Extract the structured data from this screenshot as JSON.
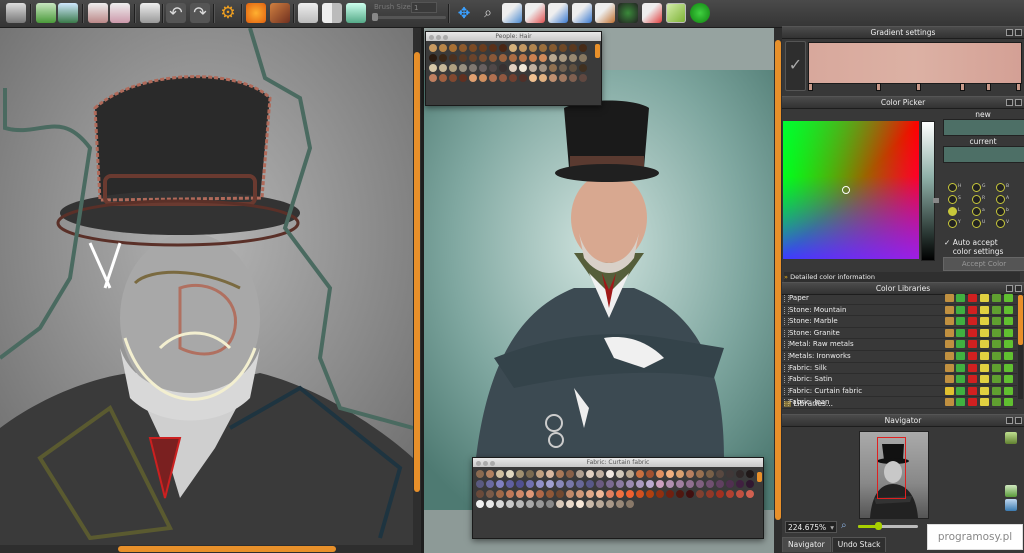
{
  "toolbar": {
    "brush_size_label": "Brush Size:",
    "brush_size_value": "1",
    "icons": [
      "open-image-icon",
      "export-icon",
      "save-icon",
      "undo-stack-icon",
      "clipboard-icon",
      "print-icon",
      "undo-icon",
      "redo-icon",
      "settings-gear-icon",
      "butterfly-icon",
      "picture-icon",
      "single-view-icon",
      "split-view-icon",
      "refresh-icon",
      "move-icon",
      "zoom-icon",
      "pen-icon",
      "pen2-icon",
      "pen3-icon",
      "pen4-icon",
      "pen5-icon",
      "brush-icon",
      "tree-icon",
      "eraser-icon",
      "paint-icon",
      "green-run-icon"
    ]
  },
  "palette_windows": [
    {
      "title": "People: Hair"
    },
    {
      "title": "Fabric: Curtain fabric"
    }
  ],
  "panels": {
    "gradient": {
      "title": "Gradient settings"
    },
    "color_picker": {
      "title": "Color Picker",
      "new_label": "new",
      "current_label": "current",
      "auto_accept": "Auto accept color settings",
      "accept_button": "Accept Color",
      "detailed": "Detailed color information",
      "swatch_color": "#4d6f66"
    },
    "color_libraries": {
      "title": "Color Libraries",
      "items": [
        "Paper",
        "Stone: Mountain",
        "Stone: Marble",
        "Stone: Granite",
        "Metal: Raw metals",
        "Metals: Ironworks",
        "Fabric: Silk",
        "Fabric: Satin",
        "Fabric: Curtain fabric",
        "Fabric: Jean"
      ],
      "libraries_button": "Libraries..."
    },
    "navigator": {
      "title": "Navigator",
      "zoom": "224.675%",
      "tabs": [
        "Navigator",
        "Undo Stack"
      ]
    }
  },
  "watermark": "programosy.pl",
  "colors": {
    "accent": "#e8902a",
    "panel_bg": "#383838",
    "slider_green": "#a7d000"
  }
}
